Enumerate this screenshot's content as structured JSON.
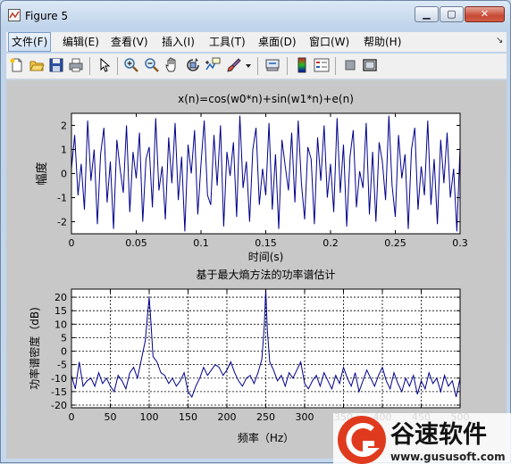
{
  "window": {
    "title": "Figure 5"
  },
  "window_controls": {
    "minimize": "▁",
    "maximize": "▢",
    "close": "✕"
  },
  "menubar": {
    "items": [
      {
        "label": "文件(F)",
        "active": true
      },
      {
        "label": "编辑(E)"
      },
      {
        "label": "查看(V)"
      },
      {
        "label": "插入(I)"
      },
      {
        "label": "工具(T)"
      },
      {
        "label": "桌面(D)"
      },
      {
        "label": "窗口(W)"
      },
      {
        "label": "帮助(H)"
      }
    ],
    "overflow": "↘"
  },
  "toolbar": {
    "icons": [
      "new-figure-icon",
      "open-file-icon",
      "save-icon",
      "print-icon",
      "edit-plot-arrow-icon",
      "zoom-in-icon",
      "zoom-out-icon",
      "pan-hand-icon",
      "rotate-3d-icon",
      "data-cursor-icon",
      "brush-icon",
      "brush-dropdown-icon",
      "link-plot-icon",
      "insert-colorbar-icon",
      "insert-legend-icon",
      "hide-plot-tools-icon",
      "show-plot-tools-icon"
    ]
  },
  "chart_data": [
    {
      "type": "line",
      "title": "x(n)=cos(w0*n)+sin(w1*n)+e(n)",
      "xlabel": "时间(s)",
      "ylabel": "幅度",
      "xlim": [
        0,
        0.3
      ],
      "ylim": [
        -2.5,
        2.5
      ],
      "xticks": [
        "0",
        "0.05",
        "0.1",
        "0.15",
        "0.2",
        "0.25",
        "0.3"
      ],
      "yticks": [
        "2",
        "1",
        "0",
        "-1",
        "-2"
      ],
      "grid": false,
      "series": [
        {
          "color": "#00008b",
          "x": [
            0,
            0.0025,
            0.005,
            0.0075,
            0.01,
            0.0125,
            0.015,
            0.0175,
            0.02,
            0.0225,
            0.025,
            0.0275,
            0.03,
            0.0325,
            0.035,
            0.0375,
            0.04,
            0.0425,
            0.045,
            0.0475,
            0.05,
            0.0525,
            0.055,
            0.0575,
            0.06,
            0.0625,
            0.065,
            0.0675,
            0.07,
            0.0725,
            0.075,
            0.0775,
            0.08,
            0.0825,
            0.085,
            0.0875,
            0.09,
            0.0925,
            0.095,
            0.0975,
            0.1,
            0.1025,
            0.105,
            0.1075,
            0.11,
            0.1125,
            0.115,
            0.1175,
            0.12,
            0.1225,
            0.125,
            0.1275,
            0.13,
            0.1325,
            0.135,
            0.1375,
            0.14,
            0.1425,
            0.145,
            0.1475,
            0.15,
            0.1525,
            0.155,
            0.1575,
            0.16,
            0.1625,
            0.165,
            0.1675,
            0.17,
            0.1725,
            0.175,
            0.1775,
            0.18,
            0.1825,
            0.185,
            0.1875,
            0.19,
            0.1925,
            0.195,
            0.1975,
            0.2,
            0.2025,
            0.205,
            0.2075,
            0.21,
            0.2125,
            0.215,
            0.2175,
            0.22,
            0.2225,
            0.225,
            0.2275,
            0.23,
            0.2325,
            0.235,
            0.2375,
            0.24,
            0.2425,
            0.245,
            0.2475,
            0.25,
            0.2525,
            0.255,
            0.2575,
            0.26,
            0.2625,
            0.265,
            0.2675,
            0.27,
            0.2725,
            0.275,
            0.2775,
            0.28,
            0.2825,
            0.285,
            0.2875,
            0.29,
            0.2925,
            0.295,
            0.2975,
            0.3
          ],
          "values": [
            0.2,
            1.6,
            -0.9,
            0.4,
            -1.5,
            2.2,
            -0.3,
            1.0,
            -2.1,
            0.8,
            1.9,
            -1.2,
            0.5,
            -2.3,
            1.4,
            0.2,
            -0.8,
            2.0,
            -1.6,
            0.9,
            -0.2,
            1.7,
            -2.0,
            0.6,
            1.1,
            -1.4,
            2.3,
            -0.7,
            0.3,
            -1.9,
            1.5,
            -0.4,
            2.1,
            -1.1,
            0.7,
            -2.4,
            1.2,
            0.0,
            1.8,
            -1.7,
            0.4,
            2.2,
            -0.9,
            -1.3,
            1.6,
            -0.5,
            2.0,
            -2.2,
            0.9,
            -0.1,
            1.3,
            -1.8,
            2.4,
            -0.6,
            0.5,
            -2.0,
            1.0,
            1.9,
            -1.3,
            0.2,
            -0.9,
            2.1,
            -1.5,
            0.8,
            -2.3,
            1.4,
            0.3,
            -0.7,
            1.7,
            -1.2,
            2.2,
            -0.4,
            -1.9,
            1.1,
            0.6,
            -2.1,
            1.5,
            -0.3,
            2.0,
            -1.0,
            0.4,
            -1.6,
            2.3,
            -0.8,
            1.2,
            -2.2,
            0.7,
            1.8,
            -1.4,
            0.1,
            -0.6,
            2.1,
            -1.7,
            0.9,
            -2.0,
            1.3,
            0.5,
            -1.1,
            2.4,
            -0.5,
            -1.8,
            1.6,
            -0.2,
            0.8,
            -2.3,
            1.0,
            1.9,
            -1.5,
            0.3,
            -0.9,
            2.2,
            -1.3,
            0.6,
            -2.1,
            1.4,
            -0.4,
            1.7,
            -1.0,
            0.2,
            -2.4,
            1.1
          ]
        }
      ]
    },
    {
      "type": "line",
      "title": "基于最大熵方法的功率谱估计",
      "xlabel": "频率（Hz）",
      "ylabel": "功率谱密度（dB)",
      "xlim": [
        0,
        500
      ],
      "ylim": [
        -21,
        23
      ],
      "xticks": [
        "0",
        "50",
        "100",
        "150",
        "200",
        "250",
        "300",
        "350",
        "400",
        "450",
        "500"
      ],
      "yticks": [
        "20",
        "15",
        "10",
        "5",
        "0",
        "-5",
        "-10",
        "-15",
        "-20"
      ],
      "grid": true,
      "series": [
        {
          "color": "#00008b",
          "x": [
            0,
            5,
            10,
            15,
            20,
            25,
            30,
            35,
            40,
            45,
            50,
            55,
            60,
            65,
            70,
            75,
            80,
            85,
            90,
            95,
            98,
            100,
            102,
            105,
            110,
            115,
            120,
            125,
            130,
            135,
            140,
            145,
            150,
            155,
            160,
            165,
            170,
            175,
            180,
            185,
            190,
            195,
            200,
            205,
            210,
            215,
            220,
            225,
            230,
            235,
            240,
            245,
            248,
            250,
            252,
            255,
            260,
            265,
            270,
            275,
            280,
            285,
            290,
            295,
            300,
            305,
            310,
            315,
            320,
            325,
            330,
            335,
            340,
            345,
            350,
            355,
            360,
            365,
            370,
            375,
            380,
            385,
            390,
            395,
            400,
            405,
            410,
            415,
            420,
            425,
            430,
            435,
            440,
            445,
            450,
            455,
            460,
            465,
            470,
            475,
            480,
            485,
            490,
            495,
            500
          ],
          "values": [
            -9,
            -14,
            -4,
            -13,
            -11,
            -10,
            -13,
            -8,
            -12,
            -10,
            -13,
            -15,
            -9,
            -11,
            -14,
            -8,
            -6,
            -10,
            -3,
            4,
            14,
            20,
            12,
            -2,
            -4,
            -8,
            -9,
            -12,
            -10,
            -13,
            -11,
            -8,
            -15,
            -17,
            -13,
            -10,
            -6,
            -9,
            -7,
            -5,
            -6,
            -9,
            -7,
            -4,
            -8,
            -11,
            -13,
            -10,
            -9,
            -12,
            -8,
            -3,
            9,
            23,
            8,
            -4,
            -7,
            -11,
            -9,
            -13,
            -8,
            -10,
            -7,
            -4,
            -12,
            -14,
            -11,
            -9,
            -13,
            -8,
            -11,
            -14,
            -9,
            -12,
            -6,
            -10,
            -13,
            -8,
            -15,
            -11,
            -7,
            -10,
            -13,
            -9,
            -6,
            -11,
            -14,
            -8,
            -12,
            -15,
            -10,
            -13,
            -9,
            -16,
            -11,
            -14,
            -8,
            -12,
            -10,
            -15,
            -9,
            -13,
            -11,
            -17,
            -10
          ]
        }
      ]
    }
  ],
  "watermark": {
    "brand": "谷速软件",
    "url": "www.gususoft.com"
  }
}
